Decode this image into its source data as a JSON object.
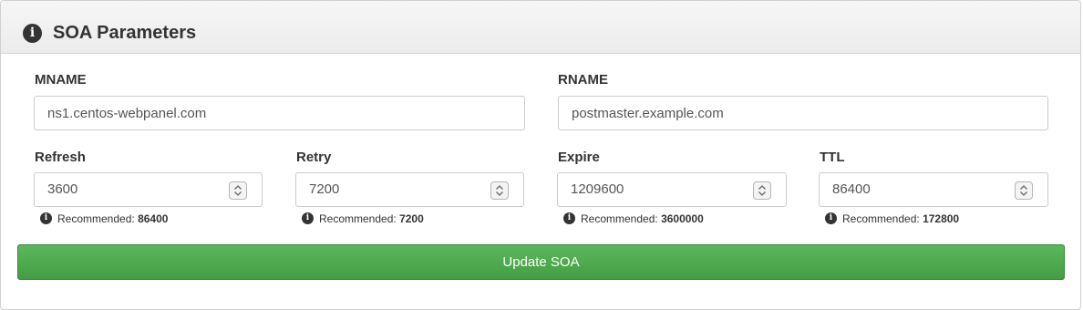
{
  "panel": {
    "title": "SOA Parameters",
    "title_icon": "info-circle-icon"
  },
  "fields": {
    "mname": {
      "label": "MNAME",
      "value": "ns1.centos-webpanel.com"
    },
    "rname": {
      "label": "RNAME",
      "value": "postmaster.example.com"
    },
    "refresh": {
      "label": "Refresh",
      "value": "3600",
      "hint_prefix": "Recommended:",
      "recommended": "86400"
    },
    "retry": {
      "label": "Retry",
      "value": "7200",
      "hint_prefix": "Recommended:",
      "recommended": "7200"
    },
    "expire": {
      "label": "Expire",
      "value": "1209600",
      "hint_prefix": "Recommended:",
      "recommended": "3600000"
    },
    "ttl": {
      "label": "TTL",
      "value": "86400",
      "hint_prefix": "Recommended:",
      "recommended": "172800"
    }
  },
  "actions": {
    "update_label": "Update SOA"
  },
  "colors": {
    "button_green": "#4cae4c",
    "heading_bg": "#f0f0f0",
    "text": "#333333"
  }
}
